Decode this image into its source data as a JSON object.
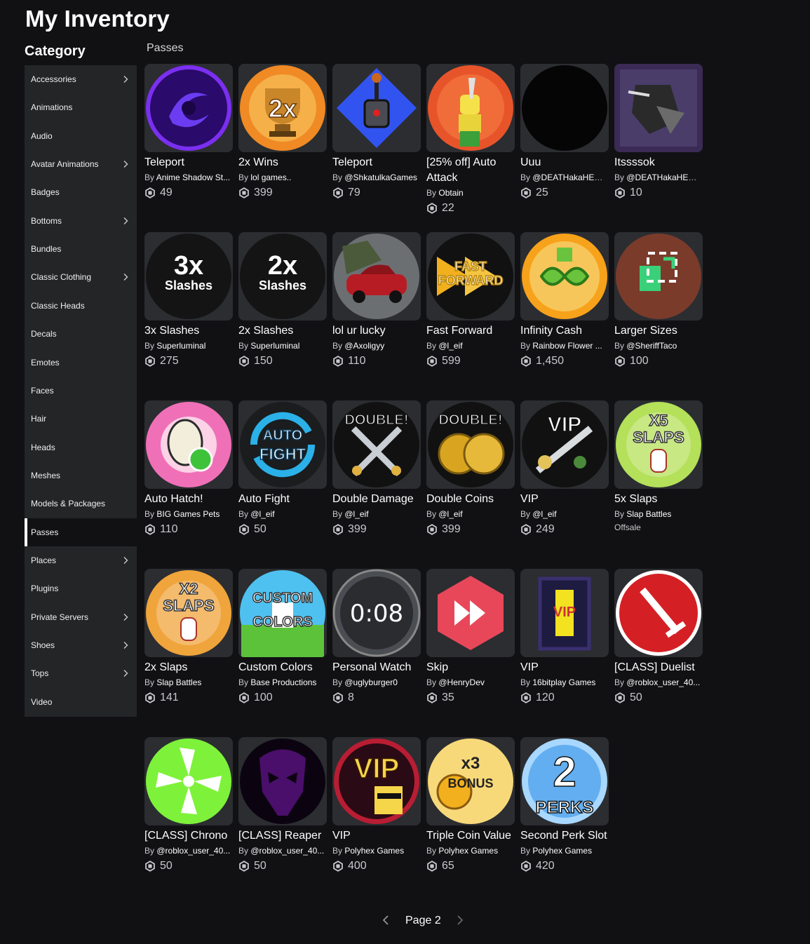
{
  "page": {
    "title": "My Inventory",
    "category_heading": "Category",
    "section": "Passes"
  },
  "sidebar": [
    {
      "label": "Accessories",
      "chevron": true
    },
    {
      "label": "Animations",
      "chevron": false
    },
    {
      "label": "Audio",
      "chevron": false
    },
    {
      "label": "Avatar Animations",
      "chevron": true
    },
    {
      "label": "Badges",
      "chevron": false
    },
    {
      "label": "Bottoms",
      "chevron": true
    },
    {
      "label": "Bundles",
      "chevron": false
    },
    {
      "label": "Classic Clothing",
      "chevron": true
    },
    {
      "label": "Classic Heads",
      "chevron": false
    },
    {
      "label": "Decals",
      "chevron": false
    },
    {
      "label": "Emotes",
      "chevron": false
    },
    {
      "label": "Faces",
      "chevron": false
    },
    {
      "label": "Hair",
      "chevron": false
    },
    {
      "label": "Heads",
      "chevron": false
    },
    {
      "label": "Meshes",
      "chevron": false
    },
    {
      "label": "Models & Packages",
      "chevron": false
    },
    {
      "label": "Passes",
      "chevron": false,
      "active": true
    },
    {
      "label": "Places",
      "chevron": true
    },
    {
      "label": "Plugins",
      "chevron": false
    },
    {
      "label": "Private Servers",
      "chevron": true
    },
    {
      "label": "Shoes",
      "chevron": true
    },
    {
      "label": "Tops",
      "chevron": true
    },
    {
      "label": "Video",
      "chevron": false
    }
  ],
  "items": [
    {
      "name": "Teleport",
      "creator": "Anime Shadow St...",
      "price": "49",
      "icon": "purple-portal-icon",
      "color": "#5a1fd0"
    },
    {
      "name": "2x Wins",
      "creator": "lol games..",
      "price": "399",
      "icon": "trophy-2x-icon",
      "color": "#f08a24"
    },
    {
      "name": "Teleport",
      "creator": "@ShkatulkaGames",
      "price": "79",
      "icon": "joystick-icon",
      "color": "#2f47e6"
    },
    {
      "name": "[25% off] Auto Attack",
      "creator": "Obtain",
      "price": "22",
      "icon": "sword-character-icon",
      "color": "#e8542a"
    },
    {
      "name": "Uuu",
      "creator": "@DEATHakaHEAV...",
      "price": "25",
      "icon": "black-circle-icon",
      "color": "#050505"
    },
    {
      "name": "Itssssok",
      "creator": "@DEATHakaHEAV...",
      "price": "10",
      "icon": "dark-character-icon",
      "color": "#5a3f84"
    },
    {
      "name": "3x Slashes",
      "creator": "Superluminal",
      "price": "275",
      "icon": "text-3x-slashes-icon",
      "color": "#141414"
    },
    {
      "name": "2x Slashes",
      "creator": "Superluminal",
      "price": "150",
      "icon": "text-2x-slashes-icon",
      "color": "#141414"
    },
    {
      "name": "lol ur lucky",
      "creator": "@Axoligyy",
      "price": "110",
      "icon": "red-car-icon",
      "color": "#b71c24"
    },
    {
      "name": "Fast Forward",
      "creator": "@l_eif",
      "price": "599",
      "icon": "fast-forward-icon",
      "color": "#f2b01e"
    },
    {
      "name": "Infinity Cash",
      "creator": "Rainbow Flower ...",
      "price": "1,450",
      "icon": "infinity-cash-icon",
      "color": "#f39b1a"
    },
    {
      "name": "Larger Sizes",
      "creator": "@SheriffTaco",
      "price": "100",
      "icon": "resize-icon",
      "color": "#7a3b2b"
    },
    {
      "name": "Auto Hatch!",
      "creator": "BIG Games Pets",
      "price": "110",
      "icon": "egg-icon",
      "color": "#e84e9c"
    },
    {
      "name": "Auto Fight",
      "creator": "@l_eif",
      "price": "50",
      "icon": "auto-fight-icon",
      "color": "#1ba4d8"
    },
    {
      "name": "Double Damage",
      "creator": "@l_eif",
      "price": "399",
      "icon": "crossed-swords-icon",
      "color": "#cfd6dc"
    },
    {
      "name": "Double Coins",
      "creator": "@l_eif",
      "price": "399",
      "icon": "double-coins-icon",
      "color": "#d9a520"
    },
    {
      "name": "VIP",
      "creator": "@l_eif",
      "price": "249",
      "icon": "vip-sword-icon",
      "color": "#e3c35a"
    },
    {
      "name": "5x Slaps",
      "creator": "Slap Battles",
      "price": "",
      "offsale": "Offsale",
      "icon": "glove-x5-icon",
      "color": "#b4e05a"
    },
    {
      "name": "2x Slaps",
      "creator": "Slap Battles",
      "price": "141",
      "icon": "glove-x2-icon",
      "color": "#f0a43c"
    },
    {
      "name": "Custom Colors",
      "creator": "Base Productions",
      "price": "100",
      "icon": "custom-colors-icon",
      "color": "#4fc1f0"
    },
    {
      "name": "Personal Watch",
      "creator": "@uglyburger0",
      "price": "8",
      "icon": "watch-icon",
      "color": "#3a3d41"
    },
    {
      "name": "Skip",
      "creator": "@HenryDev",
      "price": "35",
      "icon": "skip-icon",
      "color": "#e8475a"
    },
    {
      "name": "VIP",
      "creator": "16bitplay Games",
      "price": "120",
      "icon": "vip-door-icon",
      "color": "#f2e220"
    },
    {
      "name": "[CLASS] Duelist",
      "creator": "@roblox_user_40...",
      "price": "50",
      "icon": "duelist-sword-icon",
      "color": "#d42024"
    },
    {
      "name": "[CLASS] Chrono",
      "creator": "@roblox_user_40...",
      "price": "50",
      "icon": "chrono-icon",
      "color": "#7ef23a"
    },
    {
      "name": "[CLASS] Reaper",
      "creator": "@roblox_user_40...",
      "price": "50",
      "icon": "reaper-mask-icon",
      "color": "#5a0f78"
    },
    {
      "name": "VIP",
      "creator": "Polyhex Games",
      "price": "400",
      "icon": "vip-sunglasses-icon",
      "color": "#b81d33"
    },
    {
      "name": "Triple Coin Value",
      "creator": "Polyhex Games",
      "price": "65",
      "icon": "triple-coin-icon",
      "color": "#f2c43a"
    },
    {
      "name": "Second Perk Slot",
      "creator": "Polyhex Games",
      "price": "420",
      "icon": "second-perk-icon",
      "color": "#63aef0"
    }
  ],
  "thumb_text": {
    "text-3x-slashes-icon": [
      "3x",
      "Slashes"
    ],
    "text-2x-slashes-icon": [
      "2x",
      "Slashes"
    ],
    "trophy-2x-icon": [
      "2x"
    ],
    "fast-forward-icon": [
      "FAST",
      "FORWARD"
    ],
    "auto-fight-icon": [
      "AUTO",
      "FIGHT"
    ],
    "crossed-swords-icon": [
      "DOUBLE!"
    ],
    "double-coins-icon": [
      "DOUBLE!"
    ],
    "vip-sword-icon": [
      "VIP"
    ],
    "glove-x5-icon": [
      "X5",
      "SLAPS"
    ],
    "glove-x2-icon": [
      "X2",
      "SLAPS"
    ],
    "custom-colors-icon": [
      "CUSTOM",
      "COLORS"
    ],
    "watch-icon": [
      "0:08"
    ],
    "vip-door-icon": [
      "VIP"
    ],
    "vip-sunglasses-icon": [
      "VIP"
    ],
    "triple-coin-icon": [
      "x3",
      "BONUS"
    ],
    "second-perk-icon": [
      "2",
      "PERKS"
    ]
  },
  "by_prefix": "By",
  "pagination": {
    "label": "Page 2"
  }
}
